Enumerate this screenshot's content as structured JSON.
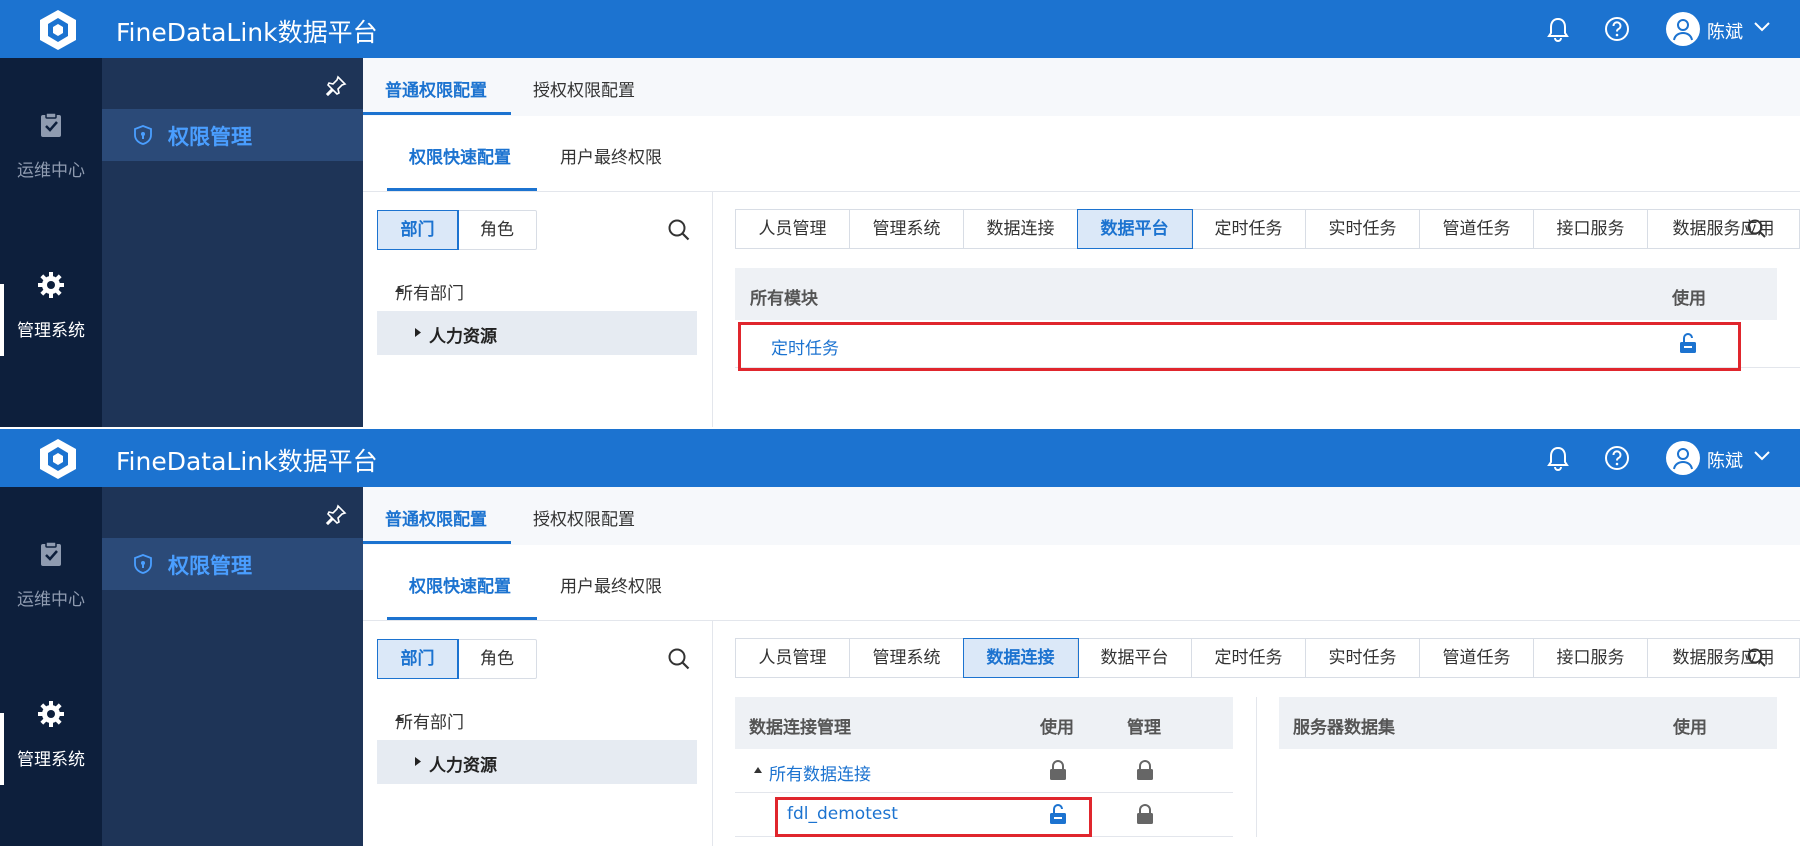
{
  "app": {
    "title": "FineDataLink数据平台",
    "user_name": "陈斌"
  },
  "rail": {
    "items": [
      {
        "label": "运维中心"
      },
      {
        "label": "管理系统"
      }
    ]
  },
  "subnav": {
    "active_label": "权限管理"
  },
  "top_tabs": [
    "普通权限配置",
    "授权权限配置"
  ],
  "sub_tabs": [
    "权限快速配置",
    "用户最终权限"
  ],
  "segment": [
    "部门",
    "角色"
  ],
  "tree": {
    "root": "所有部门",
    "child": "人力资源"
  },
  "module_tabs": [
    "人员管理",
    "管理系统",
    "数据连接",
    "数据平台",
    "定时任务",
    "实时任务",
    "管道任务",
    "接口服务",
    "数据服务应用"
  ],
  "panel1": {
    "active_tab": "数据平台",
    "headers": {
      "module": "所有模块",
      "use": "使用"
    },
    "row": {
      "name": "定时任务"
    }
  },
  "panel2": {
    "active_tab": "数据连接",
    "headers": {
      "conn": "数据连接管理",
      "use": "使用",
      "manage": "管理",
      "dataset": "服务器数据集",
      "dataset_use": "使用"
    },
    "rows": [
      {
        "name": "所有数据连接"
      },
      {
        "name": "fdl_demotest"
      }
    ]
  },
  "colors": {
    "brand": "#1c73d0",
    "highlight": "#e0262d",
    "rail": "#0d1f3c",
    "subnav": "#1e3457"
  },
  "icons": [
    "logo-icon",
    "bell-icon",
    "help-icon",
    "user-icon",
    "chevron-down-icon",
    "task-icon",
    "gear-icon",
    "pin-icon",
    "shield-icon",
    "search-icon",
    "lock-icon",
    "unlock-icon"
  ]
}
